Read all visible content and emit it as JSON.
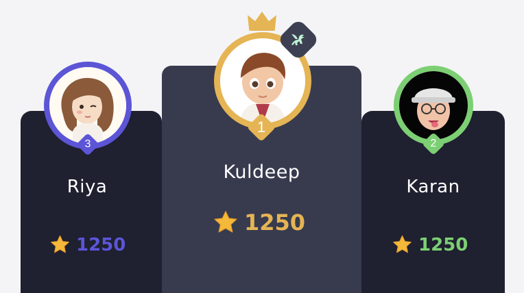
{
  "leaderboard": {
    "first": {
      "rank": "1",
      "name": "Kuldeep",
      "score": "1250",
      "accent": "#e5b454"
    },
    "second": {
      "rank": "2",
      "name": "Karan",
      "score": "1250",
      "accent": "#7ccf73"
    },
    "third": {
      "rank": "3",
      "name": "Riya",
      "score": "1250",
      "accent": "#5c55d6"
    }
  },
  "icons": {
    "crown": "crown-icon",
    "badge": "winged-lion-badge-icon",
    "star": "star-icon"
  },
  "colors": {
    "background": "#f4f4f6",
    "side_card": "#1f2030",
    "center_card": "#383b4e",
    "star": "#f4b93a"
  }
}
